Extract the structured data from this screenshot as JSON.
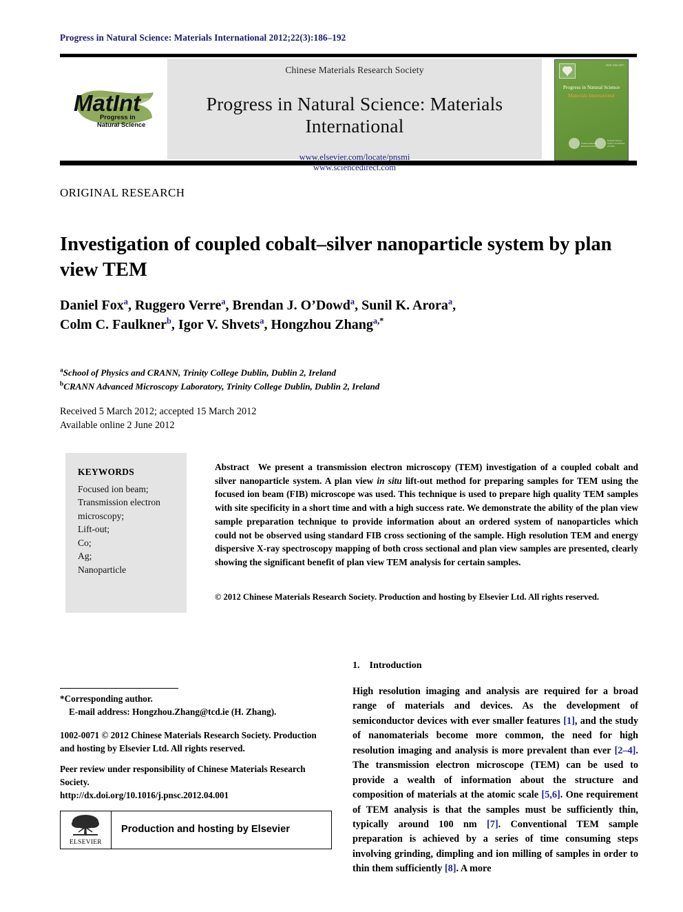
{
  "running_head": "Progress in Natural Science: Materials International 2012;22(3):186–192",
  "masthead": {
    "logo_main": "MatInt",
    "logo_sub_line1": "Progress in",
    "logo_sub_line2": "Natural Science",
    "society": "Chinese Materials Research Society",
    "journal_title": "Progress in Natural Science: Materials International",
    "url_elsevier": "www.elsevier.com/locate/pnsmi",
    "url_sciencedirect": "www.sciencedirect.com",
    "cover": {
      "issn": "ISSN 1002-0071",
      "title_line1": "Progress in Natural Science",
      "title_line2": "Materials International",
      "seal_text_1": "Chinese Materials Research Society",
      "seal_text_2": "National Natural Science Foundation of China"
    }
  },
  "article": {
    "kicker": "ORIGINAL RESEARCH",
    "title": "Investigation of coupled cobalt–silver nanoparticle system by plan view TEM",
    "authors_line1": "Daniel Fox<sup>a</sup>, Ruggero Verre<sup>a</sup>, Brendan J. O’Dowd<sup>a</sup>, Sunil K. Arora<sup>a</sup>,",
    "authors_line2": "Colm C. Faulkner<sup>b</sup>, Igor V. Shvets<sup>a</sup>, Hongzhou Zhang<sup>a</sup><sup class=\"star\">,*</sup>",
    "affiliation_a": "<sup>a</sup>School of Physics and CRANN, Trinity College Dublin, Dublin 2, Ireland",
    "affiliation_b": "<sup>b</sup>CRANN Advanced Microscopy Laboratory, Trinity College Dublin, Dublin 2, Ireland",
    "received": "Received 5 March 2012; accepted 15 March 2012",
    "available_online": "Available online 2 June 2012"
  },
  "keywords": {
    "heading": "KEYWORDS",
    "items": "Focused ion beam;\nTransmission electron microscopy;\nLift-out;\nCo;\nAg;\nNanoparticle"
  },
  "abstract": {
    "label": "Abstract",
    "part1": "We present a transmission electron microscopy (TEM) investigation of a coupled cobalt and silver nanoparticle system. A plan view ",
    "italic": "in situ",
    "part2": " lift-out method for preparing samples for TEM using the focused ion beam (FIB) microscope was used. This technique is used to prepare high quality TEM samples with site specificity in a short time and with a high success rate. We demonstrate the ability of the plan view sample preparation technique to provide information about an ordered system of nanoparticles which could not be observed using standard FIB cross sectioning of the sample. High resolution TEM and energy dispersive X-ray spectroscopy mapping of both cross sectional and plan view samples are presented, clearly showing the significant benefit of plan view TEM analysis for certain samples.",
    "copyright": "© 2012 Chinese Materials Research Society. Production and hosting by Elsevier Ltd. All rights reserved."
  },
  "footnotes": {
    "corresponding": "*Corresponding author.",
    "email": "E-mail address: Hongzhou.Zhang@tcd.ie (H. Zhang).",
    "issn_line": "1002-0071 © 2012 Chinese Materials Research Society. Production and hosting by Elsevier Ltd. All rights reserved.",
    "peer_review": "Peer review under responsibility of Chinese Materials Research Society.",
    "doi": "http://dx.doi.org/10.1016/j.pnsc.2012.04.001",
    "elsevier_box_label": "Production and hosting by Elsevier",
    "elsevier_wordmark": "ELSEVIER"
  },
  "section": {
    "number": "1.",
    "heading": "Introduction",
    "paragraph_html": "High resolution imaging and analysis are required for a broad range of materials and devices. As the development of semiconductor devices with ever smaller features <span class=\"ref\">[1]</span>, and the study of nanomaterials become more common, the need for high resolution imaging and analysis is more prevalent than ever <span class=\"ref\">[2–4]</span>. The transmission electron microscope (TEM) can be used to provide a wealth of information about the structure and composition of materials at the atomic scale <span class=\"ref\">[5,6]</span>. One requirement of TEM analysis is that the samples must be sufficiently thin, typically around 100 nm <span class=\"ref\">[7]</span>. Conventional TEM sample preparation is achieved by a series of time consuming steps involving grinding, dimpling and ion milling of samples in order to thin them sufficiently <span class=\"ref\">[8]</span>. A more"
  },
  "colors": {
    "running_head": "#1a1a6e",
    "link_blue": "#1a1a8c",
    "reference_blue": "#1f1f9c",
    "cover_green": "#6a9a3c",
    "cover_orange": "#f2a33c",
    "panel_gray": "#e3e3e3"
  }
}
